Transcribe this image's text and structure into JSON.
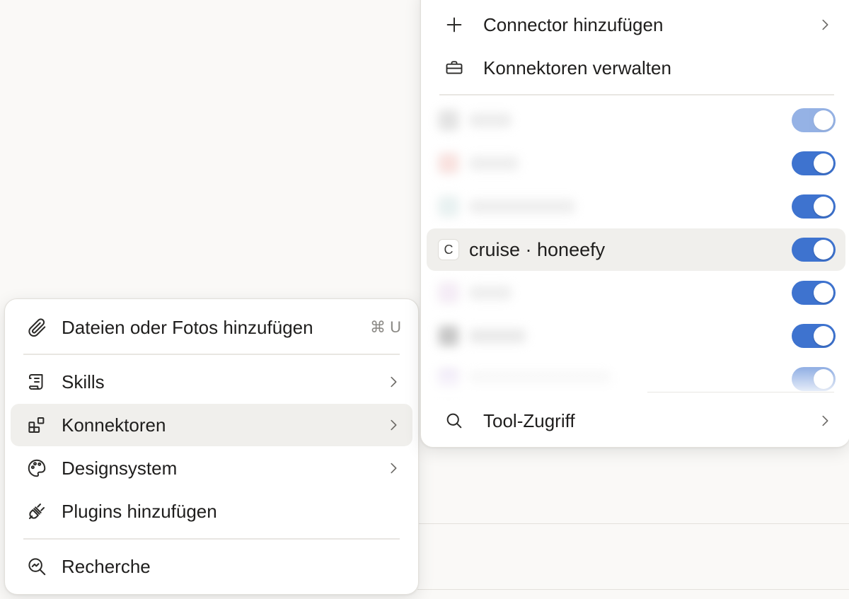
{
  "left_menu": {
    "items": [
      {
        "label": "Dateien oder Fotos hinzufügen",
        "shortcut": "⌘ U",
        "icon": "paperclip-icon"
      },
      {
        "label": "Skills",
        "icon": "scroll-icon"
      },
      {
        "label": "Konnektoren",
        "icon": "grid-plus-icon"
      },
      {
        "label": "Designsystem",
        "icon": "palette-icon"
      },
      {
        "label": "Plugins hinzufügen",
        "icon": "plug-icon"
      },
      {
        "label": "Recherche",
        "icon": "research-icon"
      }
    ]
  },
  "right_menu": {
    "add_connector": "Connector hinzufügen",
    "manage_connectors": "Konnektoren verwalten",
    "connectors": [
      {
        "label": "",
        "enabled": true
      },
      {
        "label": "",
        "enabled": true
      },
      {
        "label": "",
        "enabled": true
      },
      {
        "label": "cruise · honeefy",
        "icon_letter": "C",
        "enabled": true
      },
      {
        "label": "",
        "enabled": true
      },
      {
        "label": "",
        "enabled": true
      },
      {
        "label": "",
        "enabled": true
      }
    ],
    "tool_access": "Tool-Zugriff"
  },
  "colors": {
    "toggle_on": "#3e73cf",
    "highlight": "#f0efec"
  }
}
